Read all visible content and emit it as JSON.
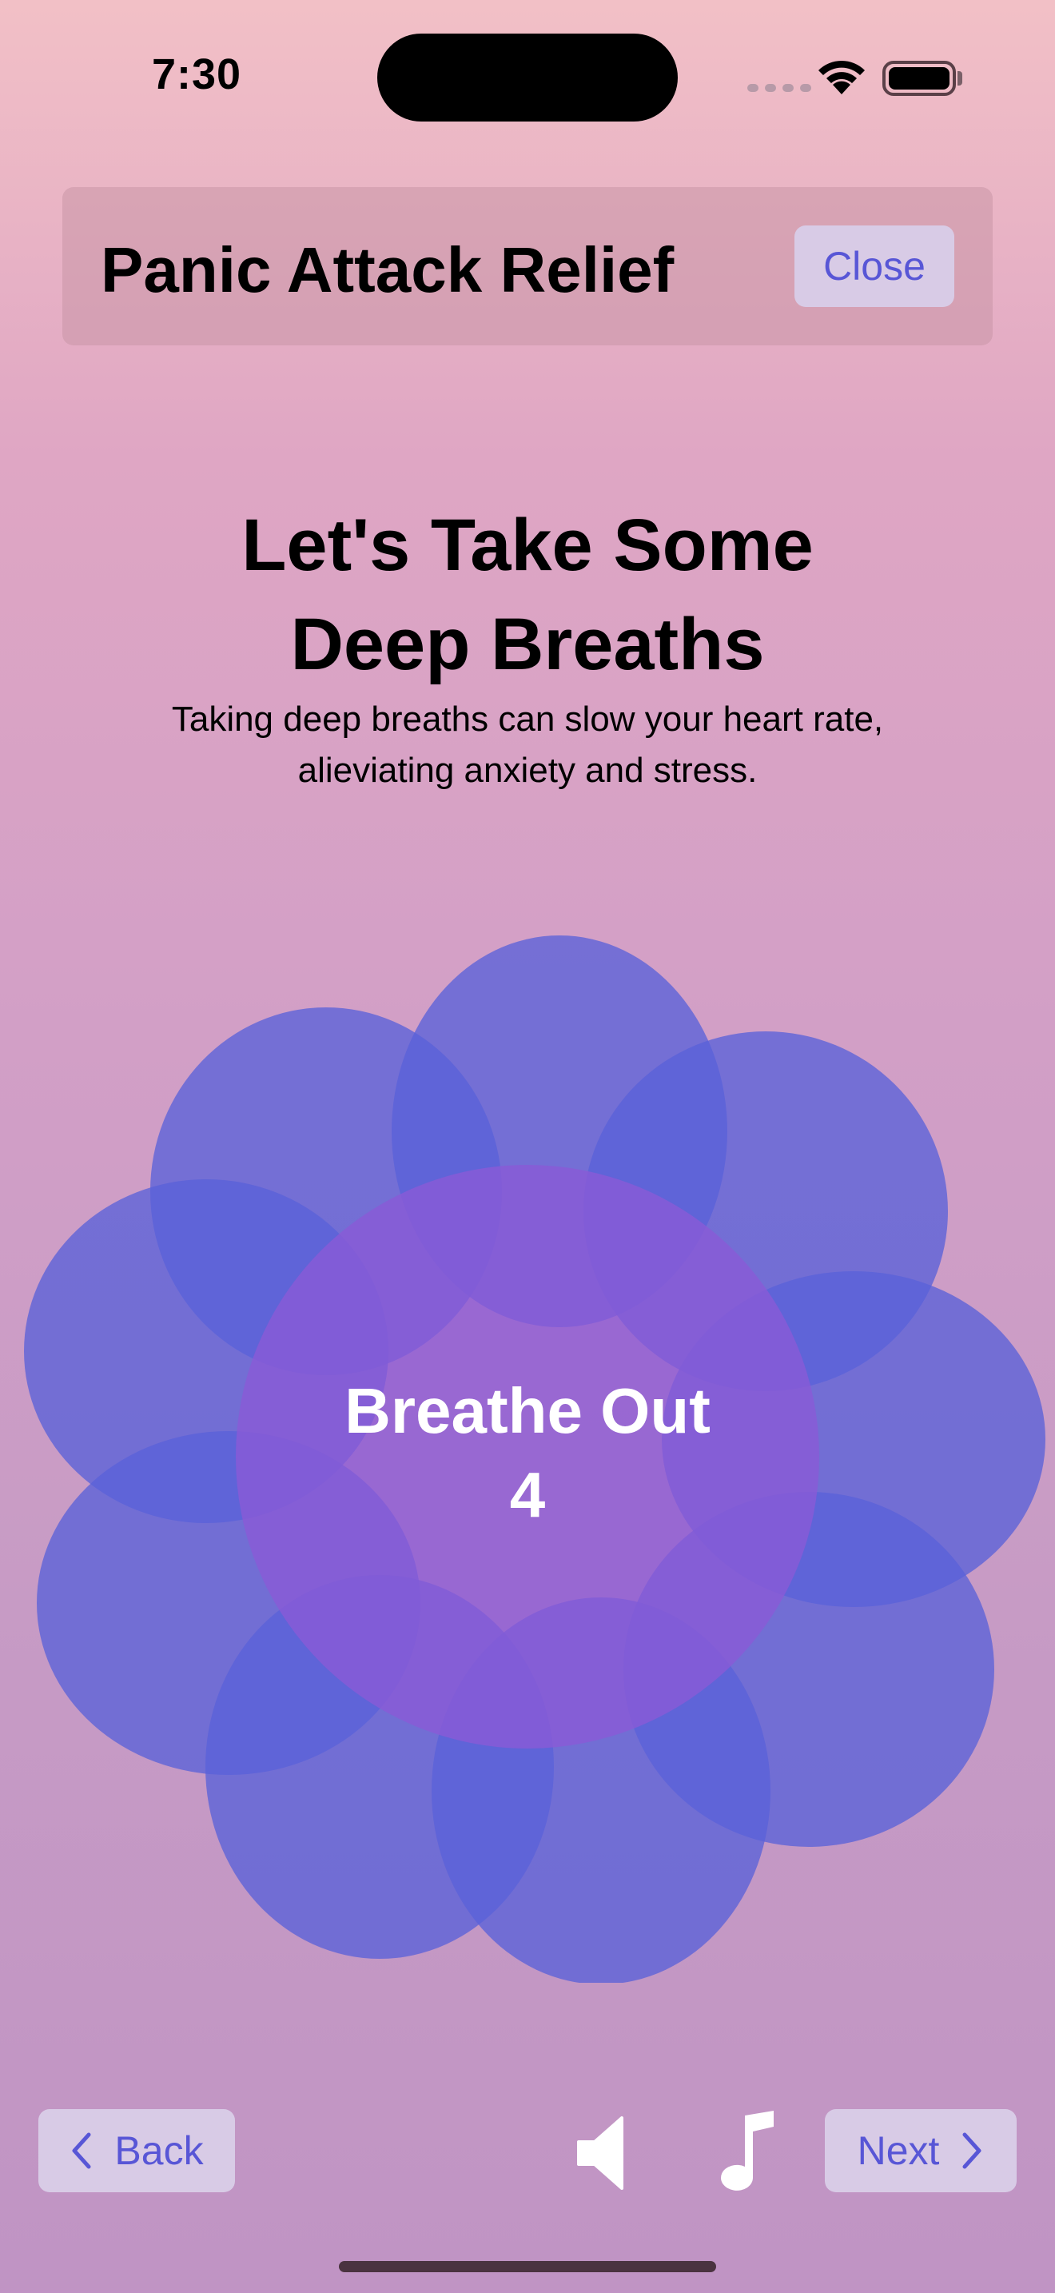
{
  "status_bar": {
    "time": "7:30"
  },
  "header": {
    "title": "Panic Attack Relief",
    "close_label": "Close"
  },
  "main": {
    "headline_line1": "Let's Take Some",
    "headline_line2": "Deep Breaths",
    "subtext_line1": "Taking deep breaths can slow your heart rate,",
    "subtext_line2": "alieviating anxiety and stress."
  },
  "breathing": {
    "instruction": "Breathe Out",
    "count": "4"
  },
  "footer": {
    "back_label": "Back",
    "next_label": "Next",
    "speaker_icon": "speaker-icon",
    "music_icon": "music-note-icon"
  },
  "colors": {
    "petal": "#5a62d8",
    "center": "#8a5ad6",
    "button_bg": "#d8cbe6",
    "accent": "#5856d6"
  }
}
